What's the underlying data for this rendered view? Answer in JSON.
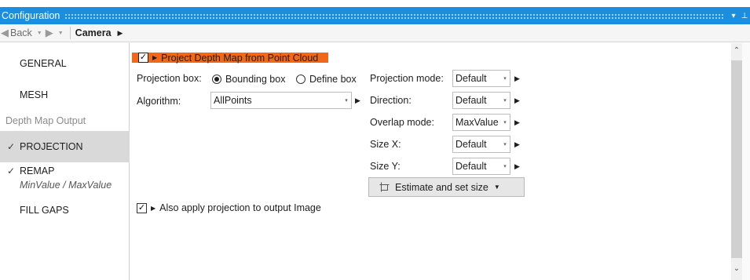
{
  "window": {
    "title": "Configuration",
    "menu_glyph": "▾",
    "pin_glyph": "⊥"
  },
  "nav": {
    "back_label": "Back",
    "breadcrumb": "Camera"
  },
  "sidebar": {
    "items": [
      {
        "label": "GENERAL",
        "checked": false
      },
      {
        "label": "MESH",
        "checked": false
      }
    ],
    "section_header": "Depth Map Output",
    "projection": {
      "label": "PROJECTION",
      "check": "✓",
      "selected": true
    },
    "remap": {
      "label": "REMAP",
      "check": "✓",
      "sub": "MinValue / MaxValue"
    },
    "fill_gaps": {
      "label": "FILL GAPS"
    }
  },
  "section": {
    "title": "Project Depth Map from Point Cloud",
    "checked": true,
    "highlight_color": "#f06818"
  },
  "form": {
    "projection_box_label": "Projection box:",
    "bounding_box_label": "Bounding box",
    "define_box_label": "Define box",
    "algorithm_label": "Algorithm:",
    "algorithm_value": "AllPoints",
    "projection_mode_label": "Projection mode:",
    "projection_mode_value": "Default",
    "direction_label": "Direction:",
    "direction_value": "Default",
    "overlap_mode_label": "Overlap mode:",
    "overlap_mode_value": "MaxValue",
    "size_x_label": "Size X:",
    "size_x_value": "Default",
    "size_y_label": "Size Y:",
    "size_y_value": "Default",
    "estimate_button_label": "Estimate and set size",
    "also_apply_label": "Also apply projection to output Image",
    "also_apply_checked": true
  },
  "icons": {
    "checkbox_check": "✓",
    "mini_arrow": "▶",
    "dropdown_caret": "▾",
    "button_caret": "▼",
    "scroll_up": "⌃",
    "scroll_down": "⌄"
  },
  "colors": {
    "titlebar": "#1c8ee0",
    "accent_orange": "#f06818"
  }
}
